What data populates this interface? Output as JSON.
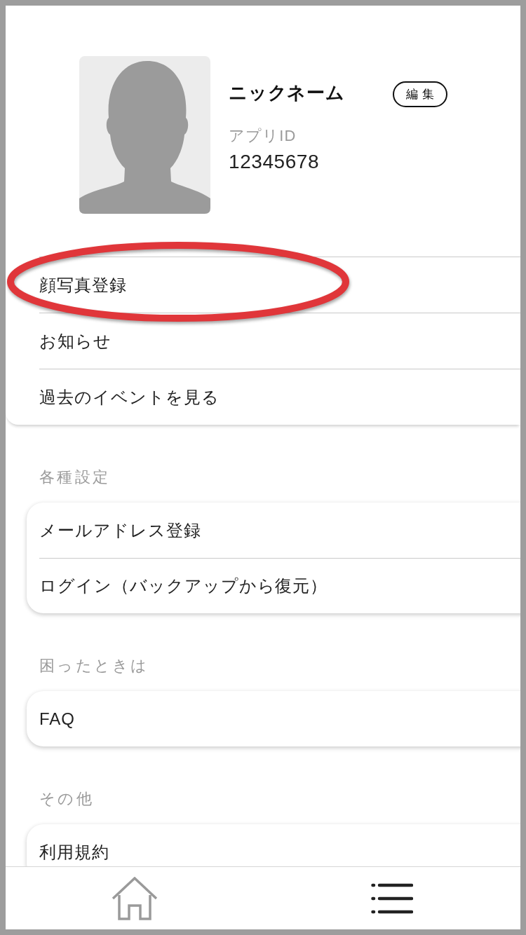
{
  "profile": {
    "nickname": "ニックネーム",
    "edit_button": "編集",
    "app_id_label": "アプリID",
    "app_id": "12345678"
  },
  "menu": [
    {
      "label": "顔写真登録",
      "circled": true
    },
    {
      "label": "お知らせ",
      "circled": false
    },
    {
      "label": "過去のイベントを見る",
      "circled": false
    }
  ],
  "sections": [
    {
      "title": "各種設定",
      "items": [
        {
          "label": "メールアドレス登録"
        },
        {
          "label": "ログイン（バックアップから復元）"
        }
      ]
    },
    {
      "title": "困ったときは",
      "items": [
        {
          "label": "FAQ"
        }
      ]
    },
    {
      "title": "その他",
      "items": [
        {
          "label": "利用規約"
        }
      ]
    }
  ],
  "bottom_nav": [
    {
      "kind": "home",
      "selected": false
    },
    {
      "kind": "menu",
      "selected": true
    }
  ]
}
